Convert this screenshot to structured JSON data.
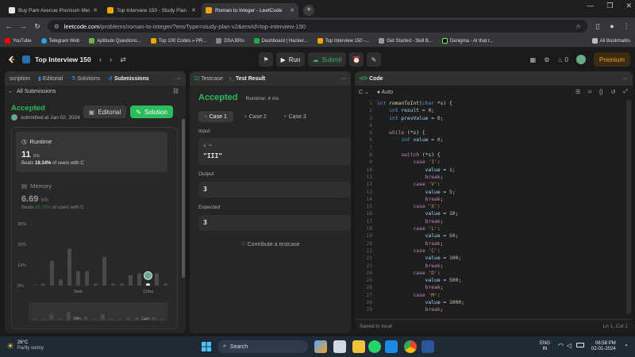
{
  "browser": {
    "tabs": [
      {
        "title": "Buy Park Avenue Premium Men",
        "active": false,
        "fav_color": "#e8e8e8"
      },
      {
        "title": "Top Interview 150 - Study Plan",
        "active": false,
        "fav_color": "#f0a500"
      },
      {
        "title": "Roman to Integer - LeetCode",
        "active": true,
        "fav_color": "#f0a500"
      }
    ],
    "new_tab": "+",
    "url_domain": "leetcode.com",
    "url_path": "/problems/roman-to-integer/?envType=study-plan-v2&envId=top-interview-150",
    "bookmarks": [
      {
        "label": "YouTube",
        "color": "#ff0000"
      },
      {
        "label": "Telegram Web",
        "color": "#2aa3e0"
      },
      {
        "label": "Aptitude Questions...",
        "color": "#6fb24b"
      },
      {
        "label": "Top 100 Codes » PR...",
        "color": "#f0a500"
      },
      {
        "label": "DSA BRo",
        "color": "#888888"
      },
      {
        "label": "Dashboard | Hacker...",
        "color": "#1ba94c"
      },
      {
        "label": "Top Interview 150 -...",
        "color": "#f0a500"
      },
      {
        "label": "Get Started - Skill B...",
        "color": "#999999"
      },
      {
        "label": "Denigma - AI that r...",
        "color": "#1a1a1a"
      }
    ],
    "all_bookmarks": "All Bookmarks"
  },
  "lc": {
    "list_title": "Top Interview 150",
    "run": "Run",
    "submit": "Submit",
    "streak": "0",
    "premium": "Premium",
    "accent": "#2cbb5d",
    "premium_color": "#ffa116"
  },
  "left": {
    "tabs": [
      "scription",
      "Editorial",
      "Solutions",
      "Submissions"
    ],
    "all_submissions": "All Submissions",
    "status": "Accepted",
    "submitted": "submitted at Jan 02, 2024",
    "editorial_btn": "Editorial",
    "solution_btn": "Solution",
    "runtime_label": "Runtime",
    "runtime_value": "11",
    "runtime_unit": "ms",
    "runtime_beats_prefix": "Beats",
    "runtime_beats": "18.34%",
    "runtime_beats_suffix": "of users with C",
    "memory_label": "Memory",
    "memory_value": "6.69",
    "memory_unit": "MB",
    "memory_beats_prefix": "Beats",
    "memory_beats": "65.29%",
    "memory_beats_suffix": "of users with C"
  },
  "chart_data": {
    "type": "bar",
    "yticks": [
      "30%",
      "20%",
      "10%",
      "0%"
    ],
    "xticks": [
      "6ms",
      "11ms"
    ],
    "values": [
      0,
      1,
      12,
      3,
      18,
      7,
      7,
      1,
      14,
      1,
      1,
      5,
      6,
      1,
      6,
      1
    ],
    "highlight_index": 13,
    "ylim": [
      0,
      30
    ]
  },
  "mini_chart": {
    "xticks": [
      "6ms",
      "11ms"
    ]
  },
  "middle": {
    "tab_testcase": "Testcase",
    "tab_result": "Test Result",
    "status": "Accepted",
    "runtime": "Runtime: 4 ms",
    "cases": [
      "Case 1",
      "Case 2",
      "Case 3"
    ],
    "input_label": "Input",
    "input_var": "s =",
    "input_value": "\"III\"",
    "output_label": "Output",
    "output_value": "3",
    "expected_label": "Expected",
    "expected_value": "3",
    "contribute": "Contribute a testcase"
  },
  "code": {
    "tab": "Code",
    "lang": "C",
    "auto": "Auto",
    "saved": "Saved to local",
    "cursor": "Ln 1, Col 1"
  },
  "taskbar": {
    "temp": "26°C",
    "weather": "Partly sunny",
    "search": "Search",
    "lang1": "ENG",
    "lang2": "IN",
    "time": "06:58 PM",
    "date": "02-01-2024"
  }
}
